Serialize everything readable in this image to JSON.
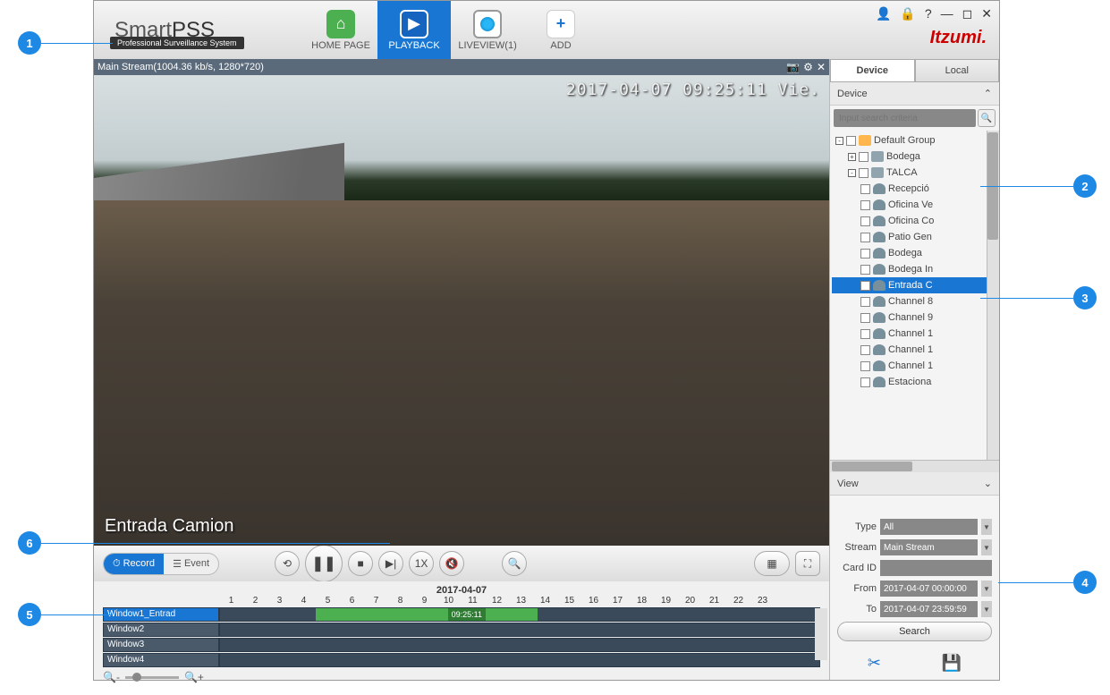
{
  "brand": {
    "name_light": "Smart",
    "name_bold": "PSS",
    "tagline": "Professional Surveillance System",
    "logo2": "Itzumi"
  },
  "nav": [
    {
      "label": "HOME PAGE",
      "active": false
    },
    {
      "label": "PLAYBACK",
      "active": true
    },
    {
      "label": "LIVEVIEW(1)",
      "active": false
    },
    {
      "label": "ADD",
      "active": false
    }
  ],
  "video": {
    "header": "Main Stream(1004.36 kb/s, 1280*720)",
    "timestamp": "2017-04-07 09:25:11 Vie.",
    "camera_name": "Entrada Camion"
  },
  "controls": {
    "record": "Record",
    "event": "Event",
    "speed": "1X"
  },
  "timeline": {
    "date": "2017-04-07",
    "hours": [
      "1",
      "2",
      "3",
      "4",
      "5",
      "6",
      "7",
      "8",
      "9",
      "10",
      "11",
      "12",
      "13",
      "14",
      "15",
      "16",
      "17",
      "18",
      "19",
      "20",
      "21",
      "22",
      "23"
    ],
    "rows": [
      {
        "label": "Window1_Entrad",
        "selected": true,
        "seg_start_pct": 16,
        "seg_width_pct": 37,
        "badge": "09:25:11",
        "badge_left_pct": 38
      },
      {
        "label": "Window2",
        "selected": false
      },
      {
        "label": "Window3",
        "selected": false
      },
      {
        "label": "Window4",
        "selected": false
      }
    ]
  },
  "sidebar": {
    "tabs": [
      "Device",
      "Local"
    ],
    "active_tab": 0,
    "section": "Device",
    "search_placeholder": "Input search criteria",
    "tree": {
      "root": "Default Group",
      "nodes": [
        {
          "level": 1,
          "exp": "+",
          "icon": "dev",
          "label": "Bodega"
        },
        {
          "level": 1,
          "exp": "-",
          "icon": "dev",
          "label": "TALCA"
        },
        {
          "level": 2,
          "icon": "cam",
          "label": "Recepció"
        },
        {
          "level": 2,
          "icon": "cam",
          "label": "Oficina Ve"
        },
        {
          "level": 2,
          "icon": "cam",
          "label": "Oficina Co"
        },
        {
          "level": 2,
          "icon": "cam",
          "label": "Patio Gen"
        },
        {
          "level": 2,
          "icon": "cam",
          "label": "Bodega"
        },
        {
          "level": 2,
          "icon": "cam",
          "label": "Bodega In"
        },
        {
          "level": 2,
          "icon": "cam",
          "label": "Entrada C",
          "selected": true
        },
        {
          "level": 2,
          "icon": "cam",
          "label": "Channel 8"
        },
        {
          "level": 2,
          "icon": "cam",
          "label": "Channel 9"
        },
        {
          "level": 2,
          "icon": "cam",
          "label": "Channel 1"
        },
        {
          "level": 2,
          "icon": "cam",
          "label": "Channel 1"
        },
        {
          "level": 2,
          "icon": "cam",
          "label": "Channel 1"
        },
        {
          "level": 2,
          "icon": "cam",
          "label": "Estaciona"
        }
      ]
    },
    "view_section": "View",
    "filters": {
      "type_label": "Type",
      "type_value": "All",
      "stream_label": "Stream",
      "stream_value": "Main Stream",
      "cardid_label": "Card ID",
      "cardid_value": "",
      "from_label": "From",
      "from_value": "2017-04-07 00:00:00",
      "to_label": "To",
      "to_value": "2017-04-07 23:59:59",
      "search": "Search"
    }
  },
  "callouts": [
    "1",
    "2",
    "3",
    "4",
    "5",
    "6"
  ]
}
